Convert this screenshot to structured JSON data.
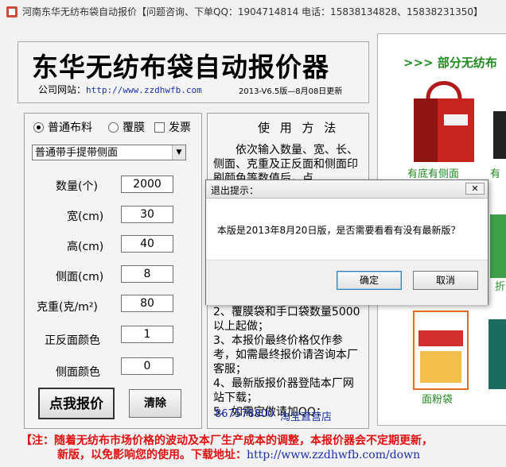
{
  "window": {
    "title": "河南东华无纺布袋自动报价【问题咨询、下单QQ：1904714814  电话：15838134828、15838231350】"
  },
  "header": {
    "app_title": "东华无纺布袋自动报价器",
    "website_label": "公司网站：",
    "website_url": "http://www.zzdhwfb.com",
    "version": "2013-V6.5版—8月08日更新"
  },
  "options": {
    "normal_fabric": "普通布料",
    "laminated": "覆膜",
    "invoice": "发票",
    "bag_type_selected": "普通带手提带侧面"
  },
  "fields": {
    "quantity": {
      "label": "数量(个)",
      "value": "2000"
    },
    "width": {
      "label": "宽(cm)",
      "value": "30"
    },
    "height": {
      "label": "高(cm)",
      "value": "40"
    },
    "side": {
      "label": "侧面(cm)",
      "value": "8"
    },
    "weight": {
      "label": "克重(克/m²)",
      "value": "80"
    },
    "front_colors": {
      "label": "正反面颜色",
      "value": "1"
    },
    "side_colors": {
      "label": "侧面颜色",
      "value": "0"
    }
  },
  "buttons": {
    "quote": "点我报价",
    "clear": "清除"
  },
  "instructions": {
    "title": "使 用 方 法",
    "lines": [
      "　　依次输入数量、宽、长、侧面、克重及正反面和侧面印刷颜色等数值后，点",
      "2、覆膜袋和手口袋数量5000以上起做；",
      "3、本报价最终价格仅作参考，如需最终报价请咨询本厂客服；",
      "4、最新版报价器登陆本厂网站下载；",
      "5、如需定做请加QQ："
    ],
    "qq": "867578800",
    "taobao": "淘宝直营店"
  },
  "products": {
    "heading": ">>> 部分无纺布",
    "caption1": "有底有侧面",
    "caption2": "有",
    "caption3": "折",
    "caption4": "面粉袋"
  },
  "dialog": {
    "title": "退出提示：",
    "message": "本版是2013年8月20日版，是否需要看看有没有最新版？",
    "ok": "确定",
    "cancel": "取消",
    "close": "✕"
  },
  "notice": {
    "line1": "【注：随着无纺布市场价格的波动及本厂生产成本的调整，本报价器会不定期更新，",
    "line2": "新版，以免影响您的使用。下载地址：",
    "url": "http://www.zzdhwfb.com/down"
  },
  "colors": {
    "accent_red": "#e01010",
    "link_blue": "#1a2fa8",
    "green": "#1f8a1f"
  }
}
